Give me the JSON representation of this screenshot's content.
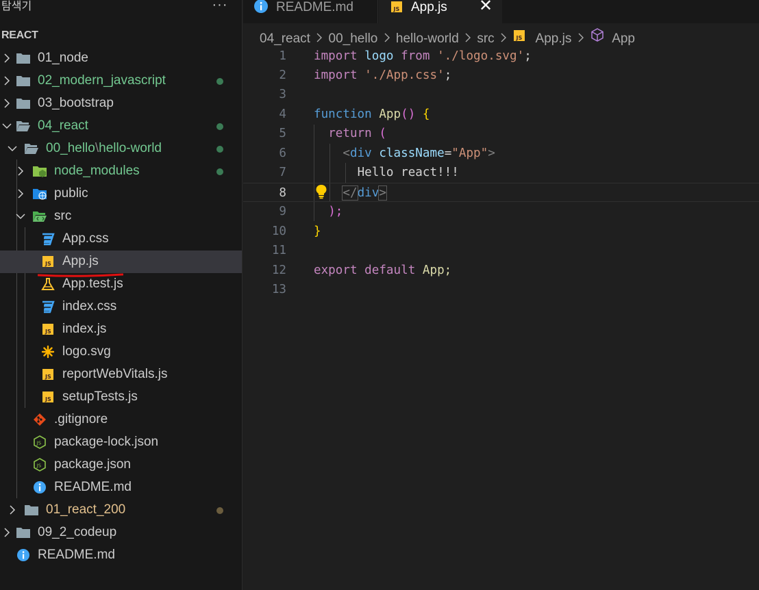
{
  "sidebar": {
    "explorer_title": "탐색기",
    "section_title": "REACT",
    "items": [
      {
        "label": "01_node",
        "color": "#cccccc"
      },
      {
        "label": "02_modern_javascript",
        "color": "#73c991",
        "dot": "#3b7b55"
      },
      {
        "label": "03_bootstrap",
        "color": "#cccccc"
      },
      {
        "label": "04_react",
        "color": "#73c991",
        "dot": "#3b7b55"
      },
      {
        "label_a": "00_hello",
        "label_sep": "\\",
        "label_b": "hello-world",
        "color": "#73c991",
        "dot": "#3b7b55"
      },
      {
        "label": "node_modules",
        "color": "#73c991",
        "dot": "#3b7b55"
      },
      {
        "label": "public",
        "color": "#cccccc"
      },
      {
        "label": "src",
        "color": "#cccccc"
      },
      {
        "label": "App.css",
        "color": "#cccccc"
      },
      {
        "label": "App.js",
        "color": "#cccccc"
      },
      {
        "label": "App.test.js",
        "color": "#cccccc"
      },
      {
        "label": "index.css",
        "color": "#cccccc"
      },
      {
        "label": "index.js",
        "color": "#cccccc"
      },
      {
        "label": "logo.svg",
        "color": "#cccccc"
      },
      {
        "label": "reportWebVitals.js",
        "color": "#cccccc"
      },
      {
        "label": "setupTests.js",
        "color": "#cccccc"
      },
      {
        "label": ".gitignore",
        "color": "#cccccc"
      },
      {
        "label": "package-lock.json",
        "color": "#cccccc"
      },
      {
        "label": "package.json",
        "color": "#cccccc"
      },
      {
        "label": "README.md",
        "color": "#cccccc"
      },
      {
        "label": "01_react_200",
        "color": "#e2c08d",
        "dot": "#6b5d3e"
      },
      {
        "label": "09_2_codeup",
        "color": "#cccccc"
      },
      {
        "label": "README.md",
        "color": "#cccccc"
      }
    ]
  },
  "tabs": [
    {
      "label": "README.md"
    },
    {
      "label": "App.js",
      "close": "✕"
    }
  ],
  "breadcrumb": [
    "04_react",
    "00_hello",
    "hello-world",
    "src",
    "App.js",
    "App"
  ],
  "code": {
    "lines": [
      "1",
      "2",
      "3",
      "4",
      "5",
      "6",
      "7",
      "8",
      "9",
      "10",
      "11",
      "12",
      "13"
    ],
    "active_line": 8,
    "t_import": "import",
    "t_logo": "logo",
    "t_from": "from",
    "t_logo_path": "'./logo.svg'",
    "t_semi": ";",
    "t_css_path": "'./App.css'",
    "t_function": "function",
    "t_App": "App",
    "t_parens": "()",
    "t_lbrace": "{",
    "t_return": "return",
    "t_lparen": "(",
    "t_lt": "<",
    "t_div": "div",
    "t_className": "className",
    "t_eq": "=",
    "t_app_str": "\"App\"",
    "t_gt": ">",
    "t_hello": "Hello react!!!",
    "t_ltslash": "</",
    "t_rparen_semi": ");",
    "t_rbrace": "}",
    "t_export": "export",
    "t_default": "default",
    "t_App_semi": "App;"
  }
}
